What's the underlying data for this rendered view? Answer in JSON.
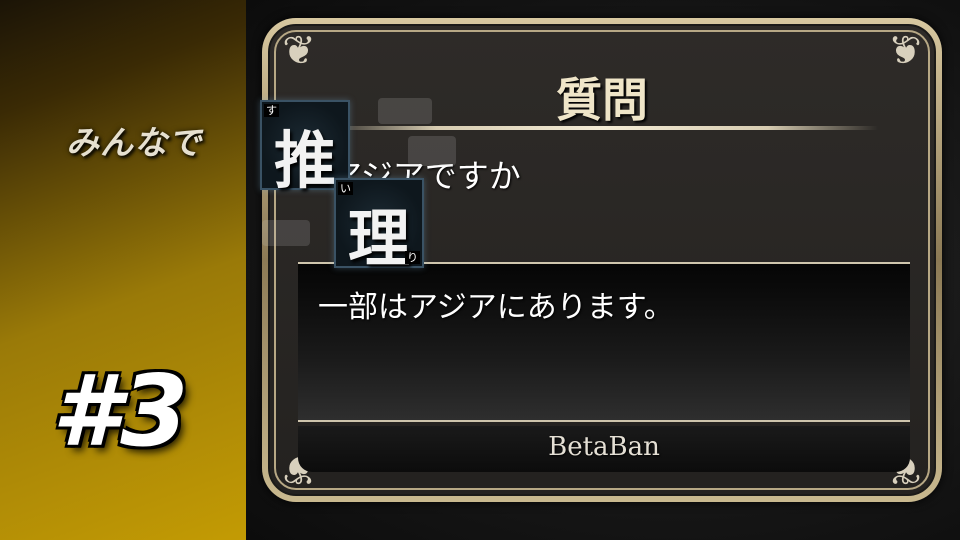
{
  "banner": {
    "subtitle": "みんなで",
    "episode": "#3",
    "tiles": [
      {
        "kanji": "推",
        "furigana": "す"
      },
      {
        "kanji": "理",
        "furigana_top": "い",
        "furigana_bottom": "り"
      }
    ]
  },
  "dialog": {
    "title": "質問",
    "question": "アジアですか",
    "answer": "一部はアジアにあります。",
    "speaker": "BetaBan"
  },
  "colors": {
    "gold": "#c39b04",
    "frame": "#c9b98f",
    "tile_border": "#3a5264"
  }
}
